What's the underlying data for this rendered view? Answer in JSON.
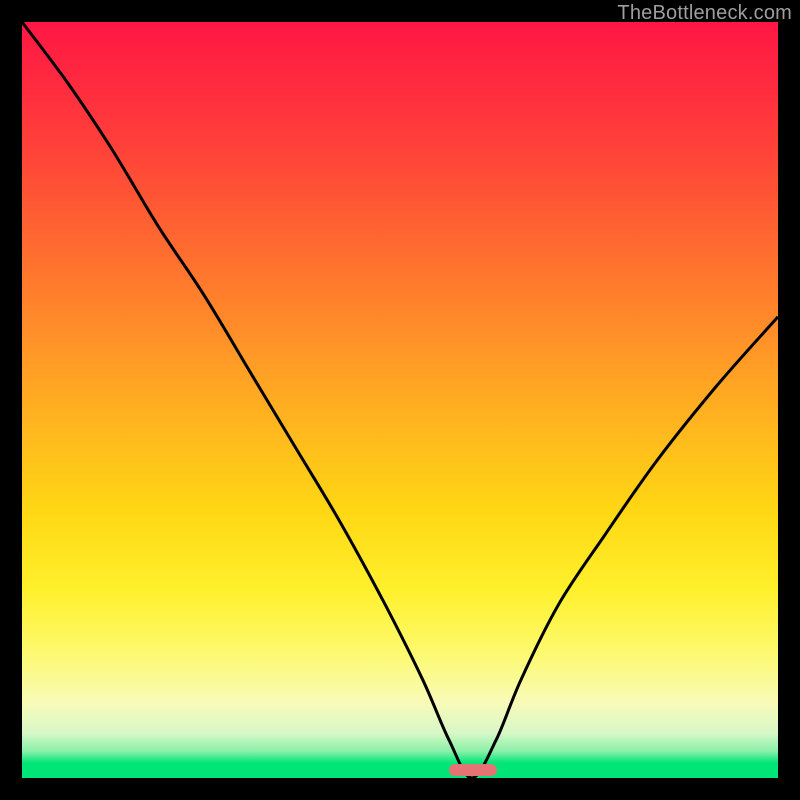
{
  "watermark": {
    "text": "TheBottleneck.com"
  },
  "marker": {
    "color": "#e57373",
    "x_frac": 0.595,
    "width_frac": 0.064
  },
  "chart_data": {
    "type": "line",
    "title": "",
    "xlabel": "",
    "ylabel": "",
    "xlim": [
      0,
      1
    ],
    "ylim": [
      0,
      1
    ],
    "grid": false,
    "legend": false,
    "background": "rainbow-vertical-gradient",
    "series": [
      {
        "name": "bottleneck-curve",
        "color": "#000000",
        "x": [
          0.0,
          0.06,
          0.12,
          0.18,
          0.24,
          0.3,
          0.36,
          0.42,
          0.48,
          0.53,
          0.565,
          0.595,
          0.627,
          0.66,
          0.71,
          0.77,
          0.84,
          0.92,
          1.0
        ],
        "values": [
          1.0,
          0.92,
          0.83,
          0.73,
          0.64,
          0.54,
          0.44,
          0.34,
          0.23,
          0.13,
          0.05,
          0.0,
          0.05,
          0.13,
          0.23,
          0.32,
          0.42,
          0.52,
          0.61
        ]
      }
    ]
  }
}
